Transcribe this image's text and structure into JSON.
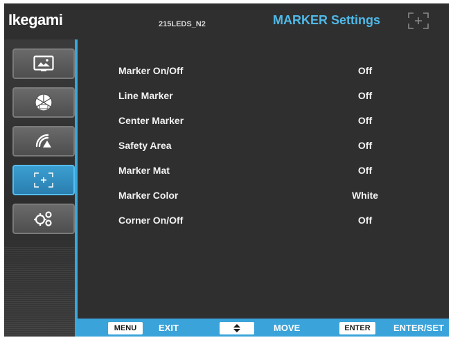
{
  "header": {
    "brand": "Ikegami",
    "model": "215LEDS_N2",
    "title": "MARKER Settings",
    "title_color": "#4fb9e8",
    "icon": "marker-frame-icon"
  },
  "sidebar": {
    "accent": "#37a8dc",
    "tabs": [
      {
        "icon": "picture-icon",
        "active": false
      },
      {
        "icon": "color-wheel-icon",
        "active": false
      },
      {
        "icon": "signal-icon",
        "active": false
      },
      {
        "icon": "marker-frame-icon",
        "active": true
      },
      {
        "icon": "gears-icon",
        "active": false
      }
    ]
  },
  "menu": {
    "items": [
      {
        "label": "Marker On/Off",
        "value": "Off"
      },
      {
        "label": "Line Marker",
        "value": "Off"
      },
      {
        "label": "Center Marker",
        "value": "Off"
      },
      {
        "label": "Safety Area",
        "value": "Off"
      },
      {
        "label": "Marker Mat",
        "value": "Off"
      },
      {
        "label": "Marker Color",
        "value": "White"
      },
      {
        "label": "Corner On/Off",
        "value": "Off"
      }
    ]
  },
  "footer": {
    "background": "#3aa3da",
    "menu_key": "MENU",
    "menu_action": "EXIT",
    "updown_icon": "up-down-arrow-icon",
    "move_action": "MOVE",
    "enter_key": "ENTER",
    "enter_action": "ENTER/SET"
  }
}
